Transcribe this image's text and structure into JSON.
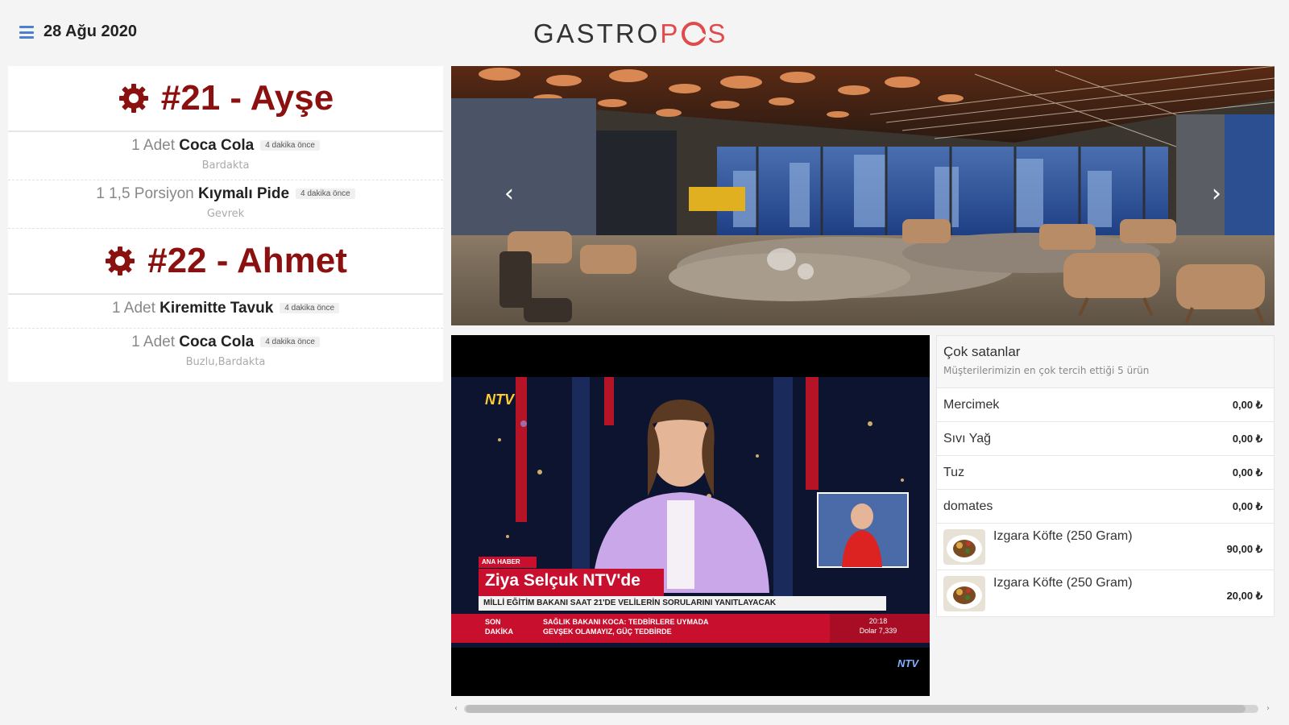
{
  "header": {
    "date": "28 Ağu 2020",
    "logo_prefix": "GASTRO",
    "logo_p": "P",
    "logo_s": "S"
  },
  "orders": [
    {
      "title": "#21 - Ayşe",
      "items": [
        {
          "qty": "1 Adet",
          "name": "Coca Cola",
          "time": "4 dakika önce",
          "note": "Bardakta"
        },
        {
          "qty": "1 1,5 Porsiyon",
          "name": "Kıymalı Pide",
          "time": "4 dakika önce",
          "note": "Gevrek"
        }
      ]
    },
    {
      "title": "#22 - Ahmet",
      "items": [
        {
          "qty": "1 Adet",
          "name": "Kiremitte Tavuk",
          "time": "4 dakika önce",
          "note": ""
        },
        {
          "qty": "1 Adet",
          "name": "Coca Cola",
          "time": "4 dakika önce",
          "note": "Buzlu,Bardakta"
        }
      ]
    }
  ],
  "tv": {
    "channel": "NTV",
    "tag": "ANA HABER",
    "headline": "Ziya Selçuk NTV'de",
    "subline": "MİLLİ EĞİTİM BAKANI SAAT 21'DE VELİLERİN SORULARINI YANITLAYACAK",
    "breaking_label_1": "SON",
    "breaking_label_2": "DAKİKA",
    "breaking_text_1": "SAĞLIK BAKANI KOCA: TEDBİRLERE UYMADA",
    "breaking_text_2": "GEVŞEK OLAMAYIZ, GÜÇ TEDBİRDE",
    "clock": "20:18",
    "clock_sub": "Dolar 7,339",
    "watermark": "NTV"
  },
  "best_sellers": {
    "title": "Çok satanlar",
    "subtitle": "Müşterilerimizin en çok tercih ettiği 5 ürün",
    "rows": [
      {
        "name": "Mercimek",
        "price": "0,00 ₺"
      },
      {
        "name": "Sıvı Yağ",
        "price": "0,00 ₺"
      },
      {
        "name": "Tuz",
        "price": "0,00 ₺"
      },
      {
        "name": "domates",
        "price": "0,00 ₺"
      },
      {
        "name": "Izgara Köfte (250 Gram)",
        "price": "90,00 ₺"
      },
      {
        "name": "Izgara Köfte (250 Gram)",
        "price": "20,00 ₺"
      }
    ]
  },
  "slider": {
    "prev_glyph": "‹",
    "next_glyph": "›"
  },
  "scrollbar": {
    "left_glyph": "‹",
    "right_glyph": "›"
  },
  "colors": {
    "order_title": "#8b1111",
    "logo_accent": "#e04a4a",
    "menu_icon": "#4a7fd4",
    "breaking_bar": "#c8102e"
  }
}
